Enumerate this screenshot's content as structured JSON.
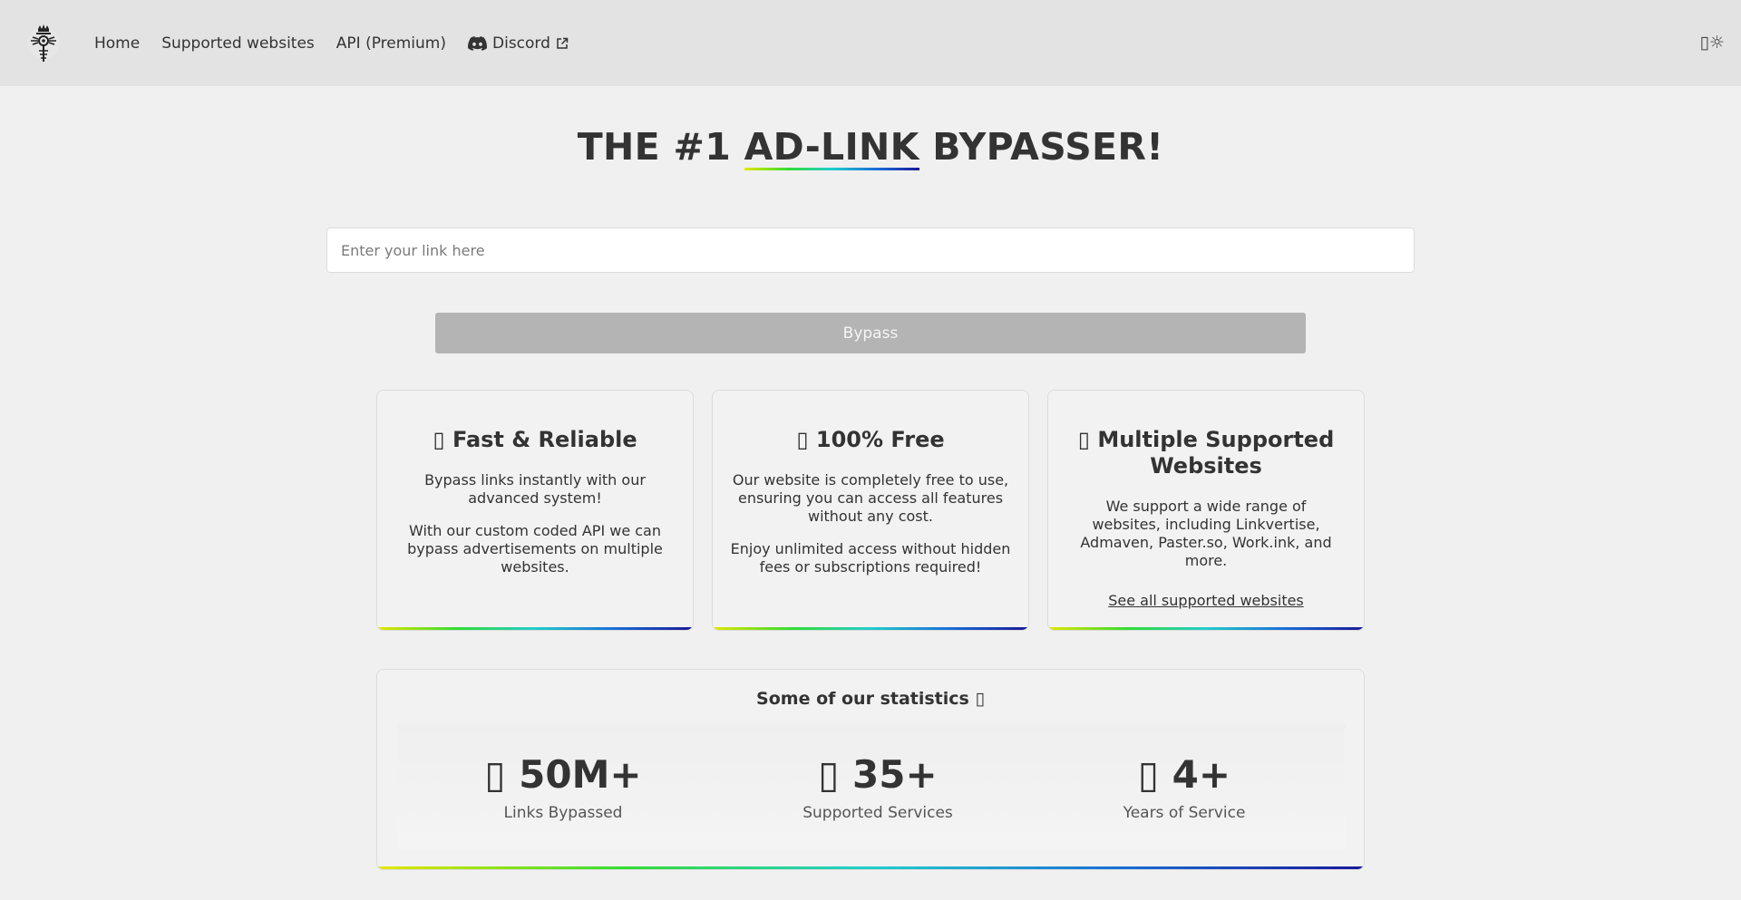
{
  "nav": {
    "links": [
      {
        "label": "Home"
      },
      {
        "label": "Supported websites"
      },
      {
        "label": "API (Premium)"
      },
      {
        "label": "Discord"
      }
    ],
    "theme_toggle": "▯☼"
  },
  "hero": {
    "title_before": "THE #1 ",
    "title_highlight": "AD-LINK",
    "title_after": " BYPASSER!"
  },
  "form": {
    "link_placeholder": "Enter your link here",
    "link_value": "",
    "bypass_label": "Bypass"
  },
  "features": [
    {
      "icon": "▯",
      "title": "Fast & Reliable",
      "paragraphs": [
        "Bypass links instantly with our advanced system!",
        "With our custom coded API we can bypass advertisements on multiple websites."
      ]
    },
    {
      "icon": "▯",
      "title": "100% Free",
      "paragraphs": [
        "Our website is completely free to use, ensuring you can access all features without any cost.",
        "Enjoy unlimited access without hidden fees or subscriptions required!"
      ]
    },
    {
      "icon": "▯",
      "title": "Multiple Supported Websites",
      "paragraphs": [
        "We support a wide range of websites, including Linkvertise, Admaven, Paster.so, Work.ink, and more."
      ],
      "link": "See all supported websites"
    }
  ],
  "stats": {
    "title": "Some of our statistics",
    "title_icon": "▯",
    "items": [
      {
        "icon": "▯",
        "value": "50M+",
        "label": "Links Bypassed"
      },
      {
        "icon": "▯",
        "value": "35+",
        "label": "Supported Services"
      },
      {
        "icon": "▯",
        "value": "4+",
        "label": "Years of Service"
      }
    ]
  },
  "colors": {
    "background": "#f0f0f0",
    "navbar": "#e3e3e3",
    "text": "#333333",
    "button": "#b4b4b4",
    "gradient": [
      "#e5e600",
      "#33dd33",
      "#22cccc",
      "#1a6fd6",
      "#1a1a99"
    ]
  }
}
